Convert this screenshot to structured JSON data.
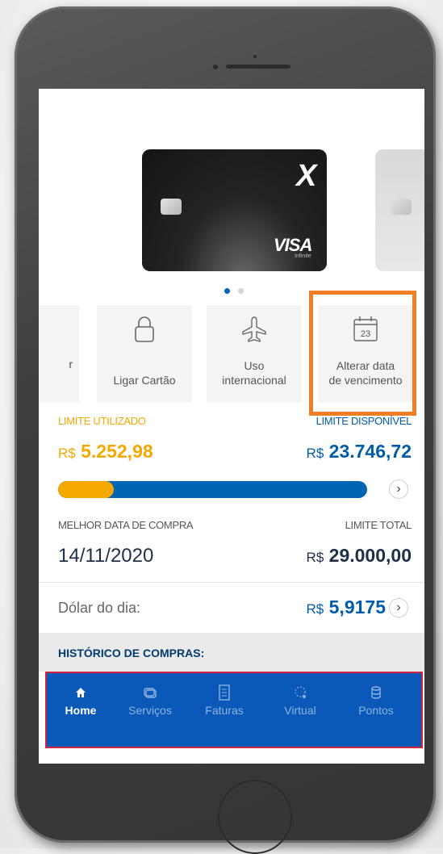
{
  "card": {
    "logo_glyph": "X",
    "brand": "VISA",
    "tier": "Infinite"
  },
  "carousel": {
    "active_index": 0,
    "count": 2
  },
  "actions": [
    {
      "label": "r",
      "icon": "partial-tile"
    },
    {
      "label": "Ligar Cartão",
      "icon": "lock-icon"
    },
    {
      "label_line1": "Uso",
      "label_line2": "internacional",
      "icon": "airplane-icon"
    },
    {
      "label_line1": "Alterar data",
      "label_line2": "de vencimento",
      "icon": "calendar-icon",
      "calendar_day": "23"
    }
  ],
  "limits": {
    "used_label": "LIMITE UTILIZADO",
    "used_currency": "R$",
    "used_value": "5.252,98",
    "available_label": "LIMITE DISPONÍVEL",
    "available_currency": "R$",
    "available_value": "23.746,72",
    "used_fraction": 0.181
  },
  "best_date": {
    "label": "MELHOR DATA DE COMPRA",
    "value": "14/11/2020"
  },
  "total_limit": {
    "label": "LIMITE TOTAL",
    "currency": "R$",
    "value": "29.000,00"
  },
  "dollar": {
    "label": "Dólar do dia:",
    "currency": "R$",
    "value": "5,9175"
  },
  "history": {
    "label": "HISTÓRICO DE COMPRAS:"
  },
  "nav": [
    {
      "label": "Home",
      "icon": "home-icon",
      "active": true
    },
    {
      "label": "Serviços",
      "icon": "services-icon",
      "active": false
    },
    {
      "label": "Faturas",
      "icon": "invoice-icon",
      "active": false
    },
    {
      "label": "Virtual",
      "icon": "virtual-card-icon",
      "active": false
    },
    {
      "label": "Pontos",
      "icon": "points-icon",
      "active": false
    }
  ],
  "colors": {
    "primary_blue": "#005ca9",
    "accent_orange": "#f5a800",
    "highlight_orange": "#f07e24",
    "nav_blue": "#0a58b7",
    "nav_border": "#d2243f"
  }
}
